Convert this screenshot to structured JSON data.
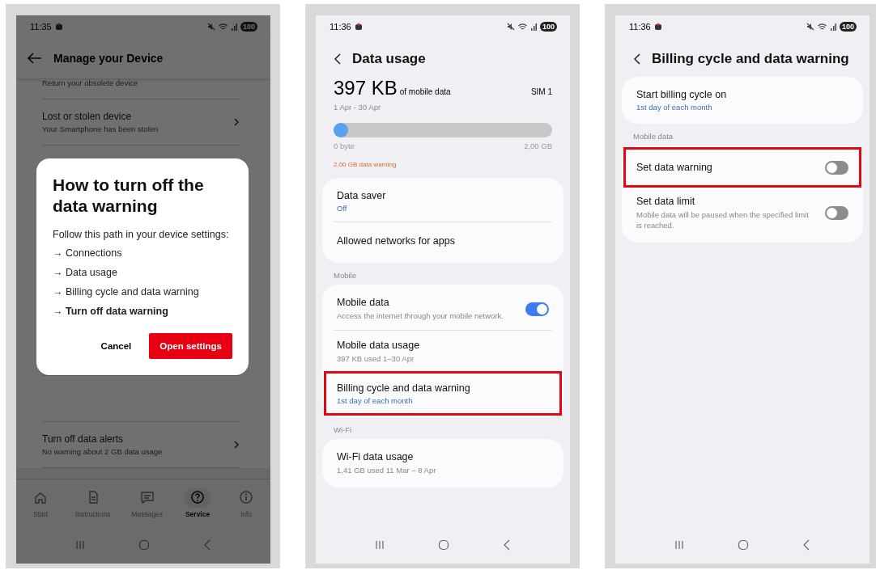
{
  "manage_device_screen": {
    "status_time": "11:35",
    "battery": "100",
    "header_title": "Manage your Device",
    "list_items": [
      {
        "subtitle": "Return your obsolete device"
      },
      {
        "title": "Lost or stolen device",
        "subtitle": "Your Smartphone has been stolen"
      },
      {
        "title": "Turn off data alerts",
        "subtitle": "No warning about 2 GB data usage"
      }
    ],
    "dialog": {
      "title": "How to turn off the data warning",
      "intro": "Follow this path in your device settings:",
      "steps": [
        {
          "text": "→ Connections",
          "bold": false
        },
        {
          "text": "→ Data usage",
          "bold": false
        },
        {
          "text": "→ Billing cycle and data warning",
          "bold": false
        },
        {
          "text": "→ Turn off data warning",
          "bold": true
        }
      ],
      "cancel": "Cancel",
      "confirm": "Open settings"
    },
    "nav": [
      {
        "kind": "home",
        "label": "Start",
        "selected": false
      },
      {
        "kind": "document",
        "label": "Instructions",
        "selected": false
      },
      {
        "kind": "message",
        "label": "Messages",
        "selected": false
      },
      {
        "kind": "help",
        "label": "Service",
        "selected": true
      },
      {
        "kind": "info",
        "label": "Info",
        "selected": false
      }
    ]
  },
  "data_usage_screen": {
    "status_time": "11:36",
    "battery": "100",
    "header_title": "Data usage",
    "amount": "397 KB",
    "amount_unit": "of mobile data",
    "sim": "SIM 1",
    "period": "1 Apr - 30 Apr",
    "usage": {
      "level": 0.0,
      "min_label": "0 byte",
      "max_label": "2,00 GB",
      "warning": "2,00 GB data warning"
    },
    "groups": [
      {
        "items": [
          {
            "title": "Data saver",
            "value": "Off",
            "highlighted": false
          },
          {
            "title": "Allowed networks for apps",
            "highlighted": false
          }
        ]
      },
      {
        "header": "Mobile",
        "items": [
          {
            "title": "Mobile data",
            "subtitle": "Access the internet through your mobile network.",
            "switch_on": true,
            "highlighted": false
          },
          {
            "title": "Mobile data usage",
            "subtitle": "397 KB used 1–30 Apr",
            "highlighted": false
          },
          {
            "title": "Billing cycle and data warning",
            "value": "1st day of each month",
            "highlighted": true
          }
        ]
      },
      {
        "header": "Wi-Fi",
        "items": [
          {
            "title": "Wi-Fi data usage",
            "subtitle": "1,41 GB used 11 Mar – 8 Apr",
            "highlighted": false
          }
        ]
      }
    ]
  },
  "billing_cycle_screen": {
    "status_time": "11:36",
    "battery": "100",
    "header_title": "Billing cycle and data warning",
    "groups": [
      {
        "items": [
          {
            "title": "Start billing cycle on",
            "value": "1st day of each month",
            "highlighted": false
          }
        ]
      },
      {
        "header": "Mobile data",
        "items": [
          {
            "title": "Set data warning",
            "switch_on": false,
            "highlighted": true
          },
          {
            "title": "Set data limit",
            "subtitle": "Mobile data will be paused when the specified limit is reached.",
            "switch_on": false,
            "highlighted": false
          }
        ]
      }
    ]
  }
}
